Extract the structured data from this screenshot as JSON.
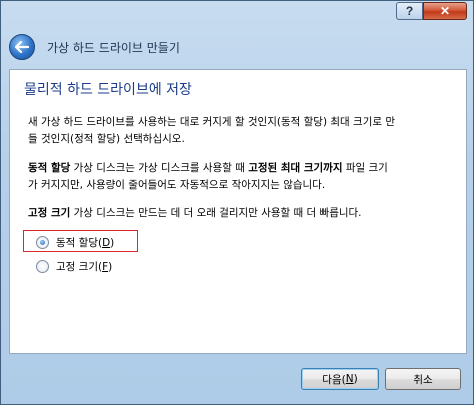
{
  "titlebar": {
    "help_label": "?",
    "close_label": "✕"
  },
  "header": {
    "title": "가상 하드 드라이브 만들기"
  },
  "page": {
    "title": "물리적 하드 드라이브에 저장",
    "para1_line1": "새 가상 하드 드라이브를 사용하는 대로 커지게 할 것인지(동적 할당) 최대 크기로 만",
    "para1_line2": "들 것인지(정적 할당) 선택하십시오.",
    "para2_bold1": "동적 할당",
    "para2_text1": " 가상 디스크는 가상 디스크를 사용할 때 ",
    "para2_bold2": "고정된 최대 크기까지",
    "para2_text2": " 파일 크기",
    "para2_line2": "가 커지지만, 사용량이 줄어들어도 자동적으로 작아지지는 않습니다.",
    "para3_bold": "고정 크기",
    "para3_text": " 가상 디스크는 만드는 데 더 오래 걸리지만 사용할 때 더 빠릅니다.",
    "options": [
      {
        "label": "동적 할당(",
        "accel": "D",
        "suffix": ")",
        "selected": true
      },
      {
        "label": "고정 크기(",
        "accel": "F",
        "suffix": ")",
        "selected": false
      }
    ]
  },
  "footer": {
    "next_label": "다음(",
    "next_accel": "N",
    "next_suffix": ")",
    "cancel_label": "취소"
  },
  "colors": {
    "title_blue": "#1b3d8a",
    "focus_red": "#d9282a"
  }
}
